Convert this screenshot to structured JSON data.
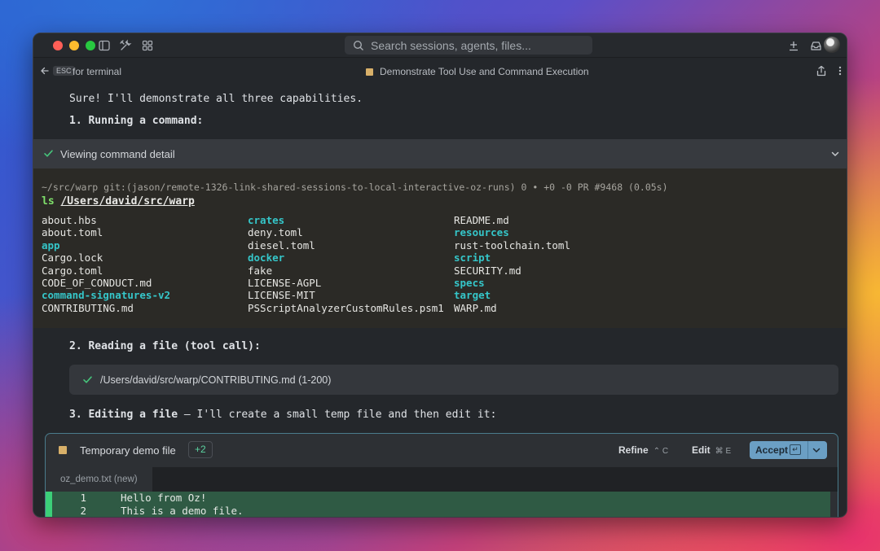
{
  "titlebar": {
    "search_placeholder": "Search sessions, agents, files..."
  },
  "subbar": {
    "esc_key": "ESC",
    "esc_label": "for terminal",
    "conversation_title": "Demonstrate Tool Use and Command Execution"
  },
  "messages": {
    "intro": "Sure! I'll demonstrate all three capabilities.",
    "step1": "1. Running a command:",
    "step2": "2. Reading a file (tool call):",
    "step3_bold": "3. Editing a file",
    "step3_rest": " — I'll create a small temp file and then edit it:"
  },
  "command_block": {
    "header": "Viewing command detail",
    "prompt": "~/src/warp git:(jason/remote-1326-link-shared-sessions-to-local-interactive-oz-runs) 0 • +0 -0 PR #9468 (0.05s)",
    "command": "ls",
    "path": "/Users/david/src/warp",
    "columns": [
      [
        {
          "name": "about.hbs",
          "dir": false
        },
        {
          "name": "about.toml",
          "dir": false
        },
        {
          "name": "app",
          "dir": true
        },
        {
          "name": "Cargo.lock",
          "dir": false
        },
        {
          "name": "Cargo.toml",
          "dir": false
        },
        {
          "name": "CODE_OF_CONDUCT.md",
          "dir": false
        },
        {
          "name": "command-signatures-v2",
          "dir": true
        },
        {
          "name": "CONTRIBUTING.md",
          "dir": false
        }
      ],
      [
        {
          "name": "crates",
          "dir": true
        },
        {
          "name": "deny.toml",
          "dir": false
        },
        {
          "name": "diesel.toml",
          "dir": false
        },
        {
          "name": "docker",
          "dir": true
        },
        {
          "name": "fake",
          "dir": false
        },
        {
          "name": "LICENSE-AGPL",
          "dir": false
        },
        {
          "name": "LICENSE-MIT",
          "dir": false
        },
        {
          "name": "PSScriptAnalyzerCustomRules.psm1",
          "dir": false
        }
      ],
      [
        {
          "name": "README.md",
          "dir": false
        },
        {
          "name": "resources",
          "dir": true
        },
        {
          "name": "rust-toolchain.toml",
          "dir": false
        },
        {
          "name": "script",
          "dir": true
        },
        {
          "name": "SECURITY.md",
          "dir": false
        },
        {
          "name": "specs",
          "dir": true
        },
        {
          "name": "target",
          "dir": true
        },
        {
          "name": "WARP.md",
          "dir": false
        }
      ]
    ]
  },
  "file_read": {
    "label": "/Users/david/src/warp/CONTRIBUTING.md (1-200)"
  },
  "diff_card": {
    "title": "Temporary demo file",
    "badge": "+2",
    "refine_label": "Refine",
    "refine_key": "⌃ C",
    "edit_label": "Edit",
    "edit_key": "⌘ E",
    "accept_label": "Accept",
    "accept_key": "↵",
    "tab_label": "oz_demo.txt (new)",
    "lines": [
      {
        "num": "1",
        "text": "Hello from Oz!"
      },
      {
        "num": "2",
        "text": "This is a demo file."
      }
    ]
  },
  "colors": {
    "directory": "#35c6c9",
    "added_line": "#2f5a44",
    "accept_button": "#6b9fc4",
    "badge_text": "#5bd3a0"
  }
}
